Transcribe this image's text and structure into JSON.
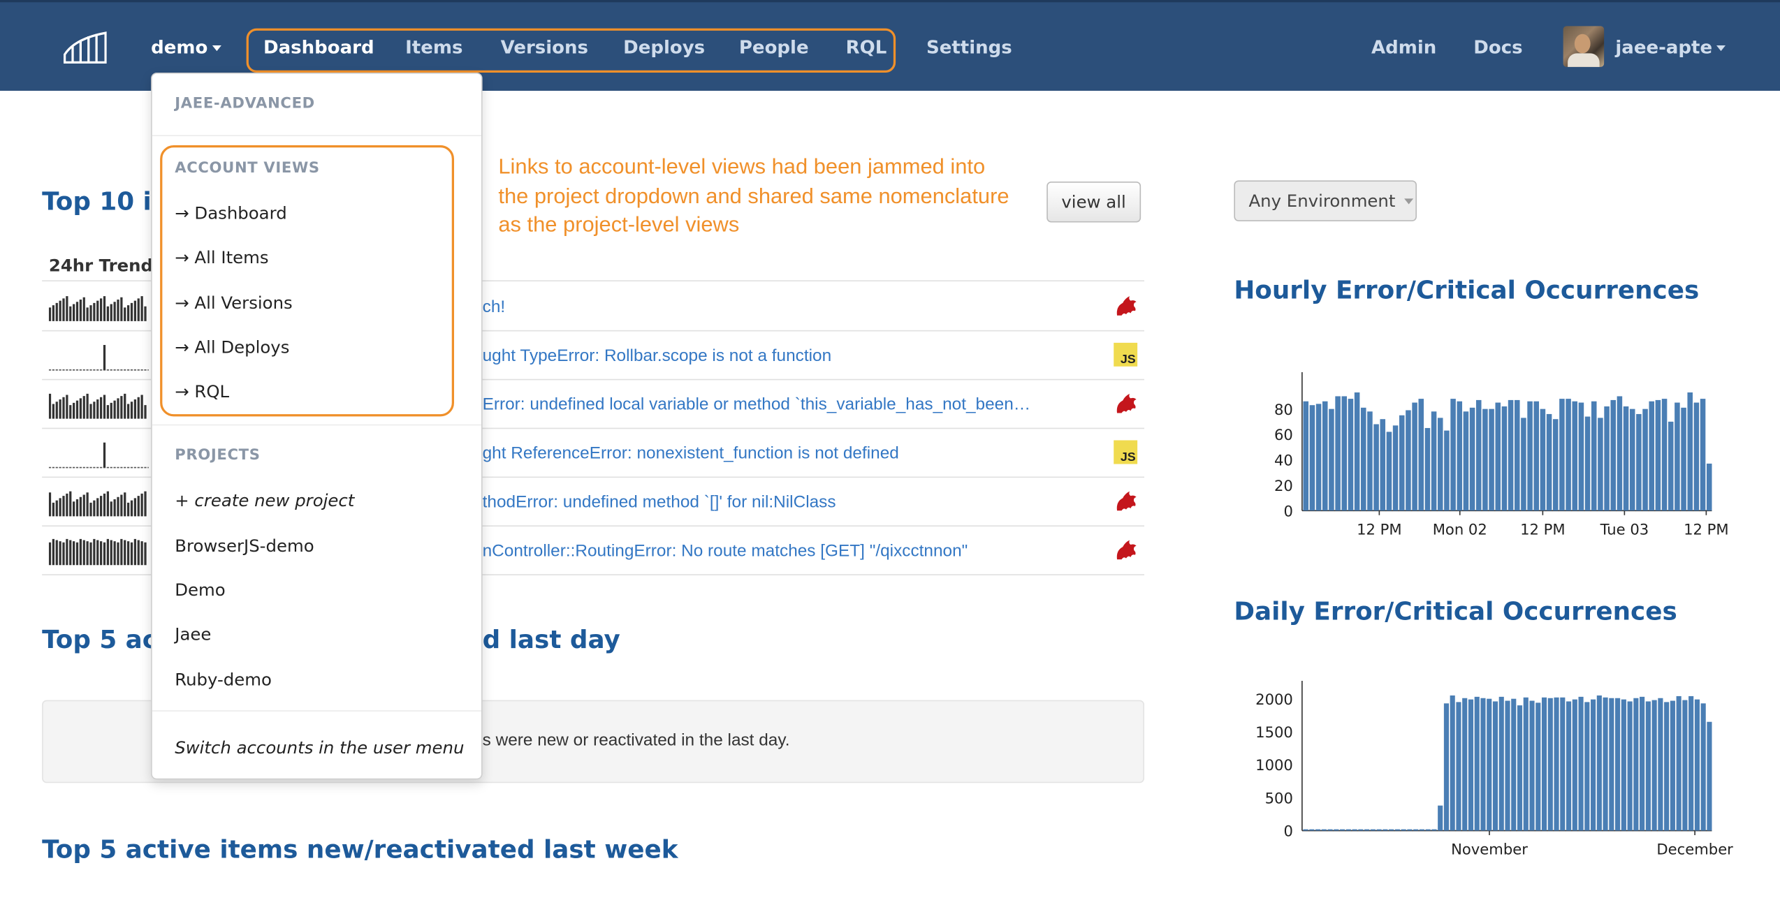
{
  "navbar": {
    "project_label": "demo",
    "tabs": [
      {
        "label": "Dashboard",
        "active": true
      },
      {
        "label": "Items"
      },
      {
        "label": "Versions"
      },
      {
        "label": "Deploys"
      },
      {
        "label": "People"
      },
      {
        "label": "RQL"
      },
      {
        "label": "Settings"
      }
    ],
    "admin_label": "Admin",
    "docs_label": "Docs",
    "username": "jaee-apte",
    "brand_color": "#2c4f7a",
    "highlight_color": "#f0902a"
  },
  "dropdown": {
    "account_header": "JAEE-ADVANCED",
    "account_views_header": "ACCOUNT VIEWS",
    "account_views": [
      "→ Dashboard",
      "→ All Items",
      "→ All Versions",
      "→ All Deploys",
      "→ RQL"
    ],
    "projects_header": "PROJECTS",
    "create_project": "+ create new project",
    "projects": [
      "BrowserJS-demo",
      "Demo",
      "Jaee",
      "Ruby-demo"
    ],
    "switch_accounts": "Switch accounts in the user menu"
  },
  "annotation": "Links to account-level views had been jammed into the project dropdown and shared same nomenclature as the project-level views",
  "main": {
    "top_items_title": "Top 10 it",
    "view_all_label": "view all",
    "trend_header": "24hr Trend",
    "items": [
      {
        "title": "ch!",
        "lang": "ruby-icon"
      },
      {
        "title": "ught TypeError: Rollbar.scope is not a function",
        "lang": "js-icon"
      },
      {
        "title": "Error: undefined local variable or method `this_variable_has_not_been…",
        "lang": "ruby-icon"
      },
      {
        "title": "ght ReferenceError: nonexistent_function is not defined",
        "lang": "js-icon"
      },
      {
        "title": "thodError: undefined method `[]' for nil:NilClass",
        "lang": "ruby-icon"
      },
      {
        "title": "nController::RoutingError: No route matches [GET] \"/qixcctnnon\"",
        "lang": "ruby-icon"
      }
    ],
    "top_day_title_left": "Top 5 act",
    "top_day_title_right": "d last day",
    "notice_text": "s were new or reactivated in the last day.",
    "top_week_title": "Top 5 active items new/reactivated last week"
  },
  "sidebar": {
    "environment_label": "Any Environment",
    "hourly_title": "Hourly Error/Critical Occurrences",
    "daily_title": "Daily Error/Critical Occurrences"
  },
  "chart_data": [
    {
      "type": "bar",
      "title": "Hourly Error/Critical Occurrences",
      "x_tick_labels": [
        "12 PM",
        "Mon 02",
        "12 PM",
        "Tue 03",
        "12 PM"
      ],
      "ylim": [
        0,
        100
      ],
      "yticks": [
        0,
        20,
        40,
        60,
        80
      ],
      "values": [
        86,
        83,
        84,
        86,
        80,
        90,
        90,
        88,
        93,
        81,
        78,
        68,
        72,
        62,
        67,
        75,
        79,
        85,
        88,
        65,
        78,
        73,
        63,
        88,
        86,
        78,
        81,
        87,
        80,
        80,
        85,
        82,
        87,
        87,
        73,
        86,
        86,
        80,
        76,
        72,
        88,
        88,
        86,
        85,
        74,
        86,
        73,
        82,
        87,
        90,
        82,
        80,
        76,
        80,
        86,
        87,
        88,
        70,
        85,
        81,
        93,
        85,
        88,
        37
      ],
      "color": "#4a7eb4"
    },
    {
      "type": "bar",
      "title": "Daily Error/Critical Occurrences",
      "x_tick_labels": [
        "November",
        "December"
      ],
      "ylim": [
        0,
        2100
      ],
      "yticks": [
        0,
        500,
        1000,
        1500,
        2000
      ],
      "values": [
        20,
        20,
        20,
        20,
        20,
        20,
        20,
        20,
        20,
        20,
        20,
        20,
        20,
        20,
        20,
        20,
        20,
        20,
        20,
        20,
        20,
        20,
        380,
        1930,
        2050,
        1950,
        2010,
        1990,
        2030,
        2010,
        2000,
        1960,
        2030,
        1970,
        2000,
        1900,
        2020,
        1970,
        1940,
        2020,
        2010,
        2020,
        2020,
        1960,
        1990,
        2030,
        1950,
        1990,
        2050,
        2020,
        2010,
        2010,
        1990,
        1960,
        2010,
        2030,
        1960,
        1980,
        2010,
        1950,
        1970,
        2040,
        1980,
        2040,
        1990,
        1930,
        1650
      ],
      "color": "#4a7eb4"
    }
  ]
}
